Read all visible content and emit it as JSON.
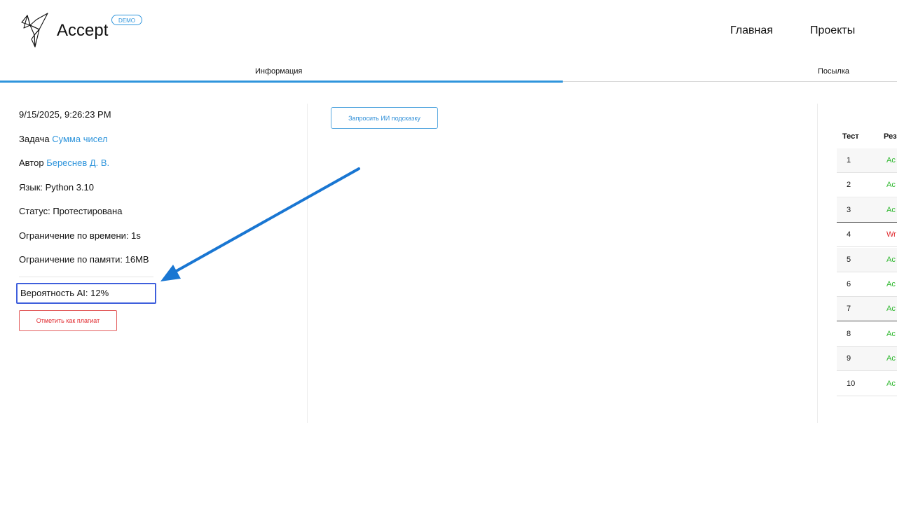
{
  "header": {
    "brand": "Accept",
    "badge": "DEMO",
    "nav": [
      "Главная",
      "Проекты"
    ]
  },
  "tabs": [
    "Информация",
    "Посылка"
  ],
  "info": {
    "datetime": "9/15/2025, 9:26:23 PM",
    "task_label": "Задача",
    "task_value": "Сумма чисел",
    "author_label": "Автор",
    "author_value": "Береснев Д. В.",
    "language": "Язык: Python 3.10",
    "status": "Статус: Протестирована",
    "time_limit": "Ограничение по времени: 1s",
    "memory_limit": "Ограничение по памяти: 16MB",
    "ai_probability": "Вероятность AI: 12%",
    "plagiarism_button": "Отметить как плагиат"
  },
  "middle": {
    "hint_button": "Запросить ИИ подсказку"
  },
  "results": {
    "headers": [
      "Тест",
      "Рез"
    ],
    "rows": [
      {
        "num": "1",
        "res": "Ac",
        "status": "ok"
      },
      {
        "num": "2",
        "res": "Ac",
        "status": "ok"
      },
      {
        "num": "3",
        "res": "Ac",
        "status": "ok"
      },
      {
        "num": "4",
        "res": "Wr",
        "status": "bad"
      },
      {
        "num": "5",
        "res": "Ac",
        "status": "ok"
      },
      {
        "num": "6",
        "res": "Ac",
        "status": "ok"
      },
      {
        "num": "7",
        "res": "Ac",
        "status": "ok"
      },
      {
        "num": "8",
        "res": "Ac",
        "status": "ok"
      },
      {
        "num": "9",
        "res": "Ac",
        "status": "ok"
      },
      {
        "num": "10",
        "res": "Ac",
        "status": "ok"
      }
    ]
  },
  "colors": {
    "accent": "#2f95dc",
    "ok": "#2eb82e",
    "bad": "#e0282d",
    "highlight_box": "#3f5fdc",
    "annotation_arrow": "#1976d2"
  },
  "icons": {
    "logo": "origami-bird-logo-icon",
    "annotation": "arrow-annotation-icon"
  }
}
